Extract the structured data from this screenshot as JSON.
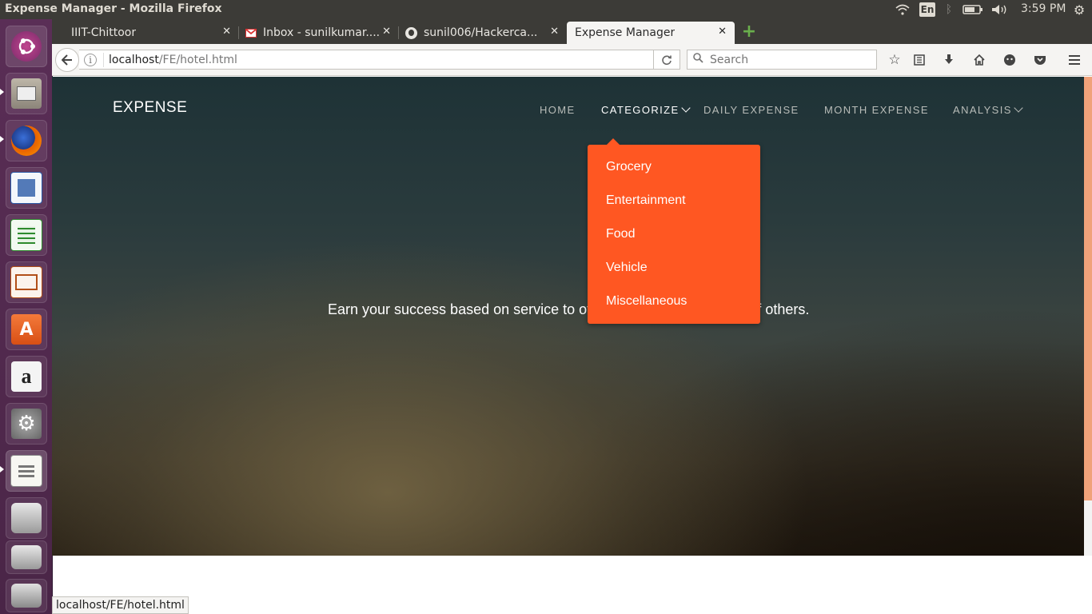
{
  "system": {
    "window_title": "Expense Manager - Mozilla Firefox",
    "keyboard_layout": "En",
    "clock": "3:59 PM",
    "icons": [
      "wifi-icon",
      "bluetooth-icon",
      "battery-icon",
      "volume-icon",
      "settings-gear-icon"
    ]
  },
  "launcher": {
    "apps": [
      "ubuntu-dash",
      "files",
      "firefox",
      "libreoffice-writer",
      "libreoffice-calc",
      "libreoffice-impress",
      "ubuntu-software",
      "amazon",
      "system-settings",
      "text-editor",
      "drive-1",
      "drive-2",
      "trash"
    ]
  },
  "tabs": [
    {
      "label": "IIIT-Chittoor",
      "icon": "none"
    },
    {
      "label": "Inbox - sunilkumar....",
      "icon": "gmail-icon"
    },
    {
      "label": "sunil006/Hackerca...",
      "icon": "github-icon"
    },
    {
      "label": "Expense Manager",
      "icon": "none",
      "active": true
    }
  ],
  "toolbar": {
    "url_host": "localhost",
    "url_path": "/FE/hotel.html",
    "search_placeholder": "Search"
  },
  "page": {
    "brand": "EXPENSE",
    "nav": {
      "home": "HOME",
      "categorize": "CATEGORIZE",
      "daily": "DAILY EXPENSE",
      "month": "MONTH EXPENSE",
      "analysis": "ANALYSIS"
    },
    "tagline": "Earn your success based on service to others, not at the expense of others.",
    "dropdown": [
      "Grocery",
      "Entertainment",
      "Food",
      "Vehicle",
      "Miscellaneous"
    ],
    "accent_color": "#ff5722"
  },
  "status_url": "localhost/FE/hotel.html"
}
